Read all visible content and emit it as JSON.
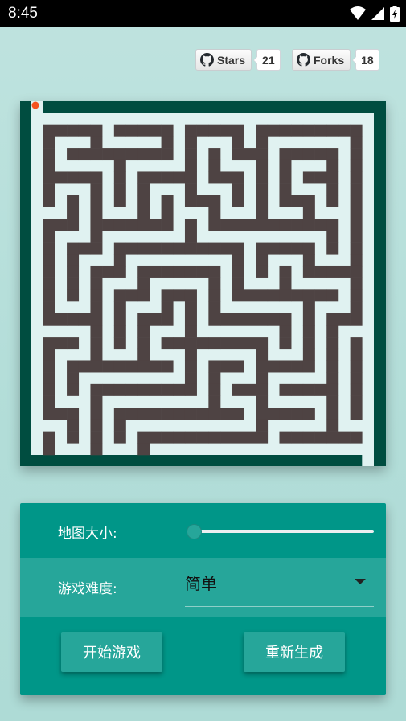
{
  "status_bar": {
    "time": "8:45"
  },
  "github": {
    "stars_label": "Stars",
    "stars_count": "21",
    "forks_label": "Forks",
    "forks_count": "18"
  },
  "maze": {
    "size": 31,
    "colors": {
      "wall": "#4e4343",
      "path": "#e0f2f1",
      "border": "#004d40",
      "player": "#f4511e"
    },
    "rows": [
      "EEEEEEEEEEEEEEEEEEEEEEEEEEEEEEE",
      "E.............................E",
      "E.#####.#####.#####.#########.E",
      "E.#...#.....#.#...#.#.......#.E",
      "E.#.#########.#.#.###.#####.#.E",
      "E.#.....#.....#.#...#.#...#.#.E",
      "E.#####.#.#####.###.#.#.###.#.E",
      "E.#...#.#.#...#...#.#.#...#.#.E",
      "E.#.#.#.#.#.#.###.#.#.###.#.#.E",
      "E...#.#...#.#...#...#...#...#.E",
      "E.###.#######.#.###########.#.E",
      "E.#...#.......#...........#.#.E",
      "E.#.###.###########.#####.#.#.E",
      "E.#.#...#.........#.#...#...#.E",
      "E.#.#.###.#######.#.#.#.#####.E",
      "E.#.#.#...#.....#.#...#.....#.E",
      "E.#.#.#.###.###.#.#########.#.E",
      "E.#...#.#...#.#.#.......#...#.E",
      "E.#####.#.###.#.#######.#.###.E",
      "E.....#.#.#...#.......#.#.#...E",
      "E.###.#.#.#.#########.#.#.#.#.E",
      "E.#...#...#...#.....#...#.#.#.E",
      "E.#.#########.#.###.#####.#.#.E",
      "E.#.#.........#.#...#.....#.#.E",
      "E.#.#.#########.#.###.#####.#.E",
      "E.#...#.........#...#.....#.#.E",
      "E.###.#.###########.#####.#.#.E",
      "E...#.#.#...........#.....#...E",
      "E.#.#.#.#.###########.#######.E",
      "E.#...#...#...................E",
      "EEEEEEEEEEEEEEEEEEEEEEEEEEEEEEE"
    ]
  },
  "controls": {
    "map_size_label": "地图大小:",
    "map_size_value": 0.02,
    "difficulty_label": "游戏难度:",
    "difficulty_value": "简单",
    "start_button": "开始游戏",
    "regenerate_button": "重新生成"
  }
}
